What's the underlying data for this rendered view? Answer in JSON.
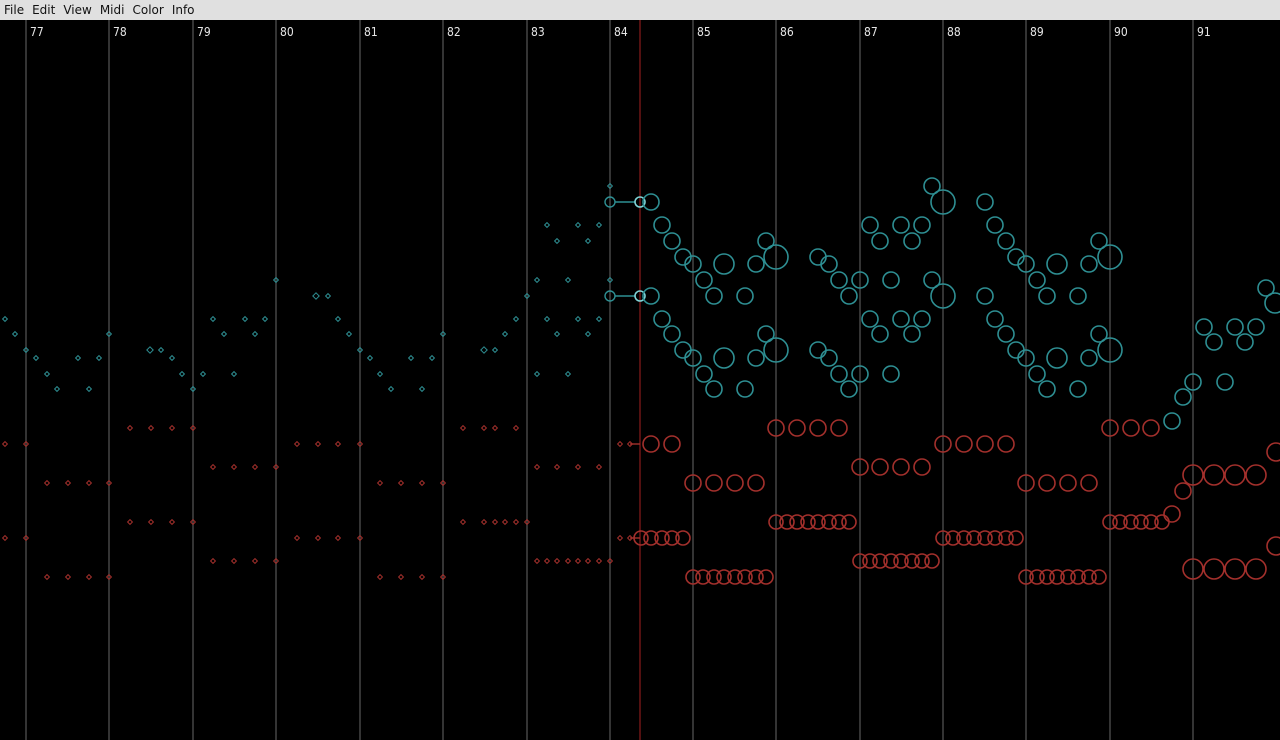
{
  "menu": {
    "items": [
      "File",
      "Edit",
      "View",
      "Midi",
      "Color",
      "Info"
    ]
  },
  "ruler": {
    "measures": [
      "77",
      "78",
      "79",
      "80",
      "81",
      "82",
      "83",
      "84",
      "85",
      "86",
      "87",
      "88",
      "89",
      "90",
      "91"
    ]
  },
  "colors": {
    "background": "#000000",
    "barline": "#4a4a4a",
    "playhead": "#8a1a1a",
    "treble_notes": "#2e8f93",
    "bass_notes": "#a3302c"
  }
}
